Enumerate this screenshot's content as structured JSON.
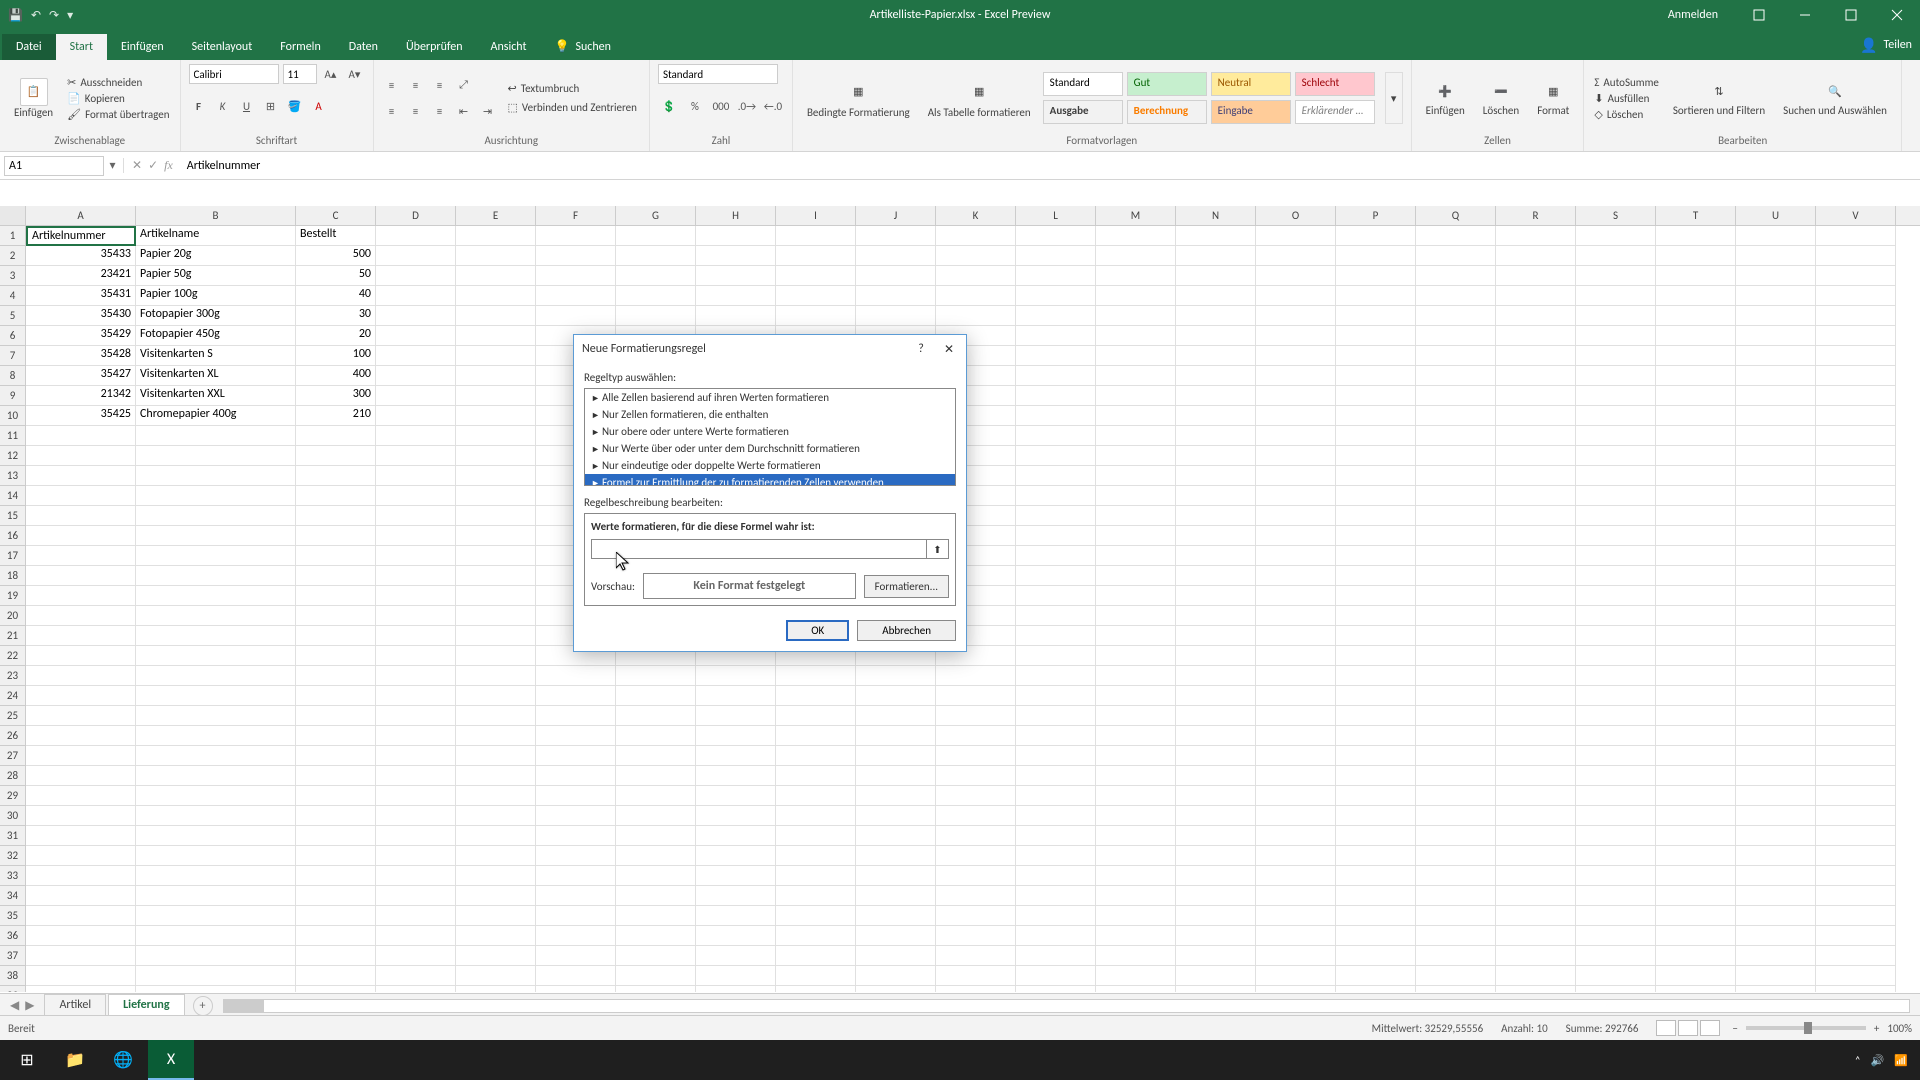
{
  "titlebar": {
    "title": "Artikelliste-Papier.xlsx - Excel Preview",
    "signin": "Anmelden"
  },
  "tabs": {
    "file": "Datei",
    "items": [
      "Start",
      "Einfügen",
      "Seitenlayout",
      "Formeln",
      "Daten",
      "Überprüfen",
      "Ansicht"
    ],
    "active_index": 0,
    "tellme": "Suchen",
    "share": "Teilen"
  },
  "ribbon": {
    "clipboard": {
      "paste": "Einfügen",
      "cut": "Ausschneiden",
      "copy": "Kopieren",
      "format_painter": "Format übertragen",
      "label": "Zwischenablage"
    },
    "font": {
      "name": "Calibri",
      "size": "11",
      "label": "Schriftart"
    },
    "alignment": {
      "wrap": "Textumbruch",
      "merge": "Verbinden und Zentrieren",
      "label": "Ausrichtung"
    },
    "number": {
      "format": "Standard",
      "label": "Zahl"
    },
    "styles": {
      "cond": "Bedingte Formatierung",
      "table": "Als Tabelle formatieren",
      "label": "Formatvorlagen",
      "gallery": [
        "Standard",
        "Gut",
        "Neutral",
        "Schlecht",
        "Ausgabe",
        "Berechnung",
        "Eingabe",
        "Erklärender …"
      ]
    },
    "cells": {
      "insert": "Einfügen",
      "delete": "Löschen",
      "format": "Format",
      "label": "Zellen"
    },
    "editing": {
      "autosum": "AutoSumme",
      "fill": "Ausfüllen",
      "clear": "Löschen",
      "sort": "Sortieren und Filtern",
      "find": "Suchen und Auswählen",
      "label": "Bearbeiten"
    }
  },
  "formula_bar": {
    "name_box": "A1",
    "formula": "Artikelnummer"
  },
  "columns": [
    "A",
    "B",
    "C",
    "D",
    "E",
    "F",
    "G",
    "H",
    "I",
    "J",
    "K",
    "L",
    "M",
    "N",
    "O",
    "P",
    "Q",
    "R",
    "S",
    "T",
    "U",
    "V"
  ],
  "table": {
    "headers": [
      "Artikelnummer",
      "Artikelname",
      "Bestellt"
    ],
    "rows": [
      [
        35433,
        "Papier 20g",
        500
      ],
      [
        23421,
        "Papier 50g",
        50
      ],
      [
        35431,
        "Papier 100g",
        40
      ],
      [
        35430,
        "Fotopapier 300g",
        30
      ],
      [
        35429,
        "Fotopapier 450g",
        20
      ],
      [
        35428,
        "Visitenkarten S",
        100
      ],
      [
        35427,
        "Visitenkarten XL",
        400
      ],
      [
        21342,
        "Visitenkarten XXL",
        300
      ],
      [
        35425,
        "Chromepapier 400g",
        210
      ]
    ]
  },
  "sheets": {
    "tabs": [
      "Artikel",
      "Lieferung"
    ],
    "active_index": 1
  },
  "statusbar": {
    "ready": "Bereit",
    "mean_label": "Mittelwert:",
    "mean": "32529,55556",
    "count_label": "Anzahl:",
    "count": "10",
    "sum_label": "Summe:",
    "sum": "292766",
    "zoom": "100%"
  },
  "dialog": {
    "title": "Neue Formatierungsregel",
    "select_type": "Regeltyp auswählen:",
    "rules": [
      "Alle Zellen basierend auf ihren Werten formatieren",
      "Nur Zellen formatieren, die enthalten",
      "Nur obere oder untere Werte formatieren",
      "Nur Werte über oder unter dem Durchschnitt formatieren",
      "Nur eindeutige oder doppelte Werte formatieren",
      "Formel zur Ermittlung der zu formatierenden Zellen verwenden"
    ],
    "selected_rule_index": 5,
    "edit_label": "Regelbeschreibung bearbeiten:",
    "formula_label": "Werte formatieren, für die diese Formel wahr ist:",
    "formula_value": "",
    "preview_label": "Vorschau:",
    "preview_text": "Kein Format festgelegt",
    "format_btn": "Formatieren...",
    "ok": "OK",
    "cancel": "Abbrechen"
  },
  "taskbar": {
    "time": ""
  }
}
